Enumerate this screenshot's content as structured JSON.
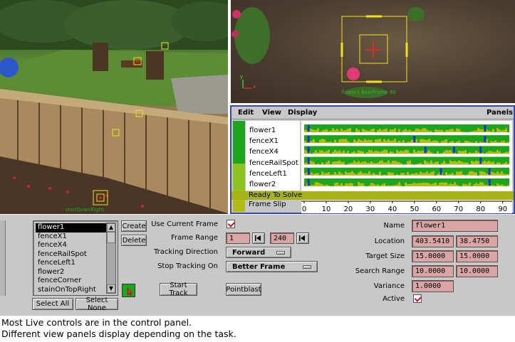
{
  "graph_editor": {
    "menu": {
      "edit": "Edit",
      "view": "View",
      "display": "Display",
      "panels": "Panels"
    },
    "tracks": [
      "flower1",
      "fenceX1",
      "fenceX4",
      "fenceRailSpot",
      "fenceLeft1",
      "flower2"
    ],
    "status": "Ready To Solve",
    "frame_slip": "Frame Slip",
    "axis_ticks": [
      "0",
      "10",
      "20",
      "30",
      "40",
      "50",
      "60",
      "70",
      "80",
      "90"
    ],
    "axis_range": [
      0,
      93
    ],
    "colors": {
      "good": "#1ea51e",
      "weak": "#b2ba14",
      "keyframe": "#2030d0",
      "border": "#3c46a8"
    }
  },
  "left_viewport": {
    "label": "stairDownRight"
  },
  "right_viewport": {
    "label": "flower1 BestFrame 80",
    "axis_y": "y",
    "axis_x": "x"
  },
  "control_panel": {
    "trackers": [
      "flower1",
      "fenceX1",
      "fenceX4",
      "fenceRailSpot",
      "fenceLeft1",
      "flower2",
      "fenceCorner",
      "stainOnTopRight"
    ],
    "selected_index": 0,
    "create_label": "Create",
    "delete_label": "Delete",
    "select_all_label": "Select All",
    "select_none_label": "Select None",
    "use_current_frame_label": "Use Current Frame",
    "frame_range_label": "Frame Range",
    "frame_start": "1",
    "frame_end": "240",
    "tracking_direction_label": "Tracking Direction",
    "tracking_direction_value": "Forward",
    "stop_tracking_label": "Stop Tracking On",
    "stop_tracking_value": "Better Frame",
    "start_track_label": "Start Track",
    "pointblast_label": "Pointblast",
    "name_label": "Name",
    "name_value": "flower1",
    "location_label": "Location",
    "location_x": "403.5410",
    "location_y": "38.4750",
    "target_size_label": "Target Size",
    "target_w": "15.0000",
    "target_h": "15.0000",
    "search_range_label": "Search Range",
    "search_w": "10.0000",
    "search_h": "10.0000",
    "variance_label": "Variance",
    "variance_value": "1.0000",
    "active_label": "Active"
  },
  "caption": {
    "line1": "Most Live controls are in the control panel.",
    "line2": "Different view panels display depending on the task."
  }
}
